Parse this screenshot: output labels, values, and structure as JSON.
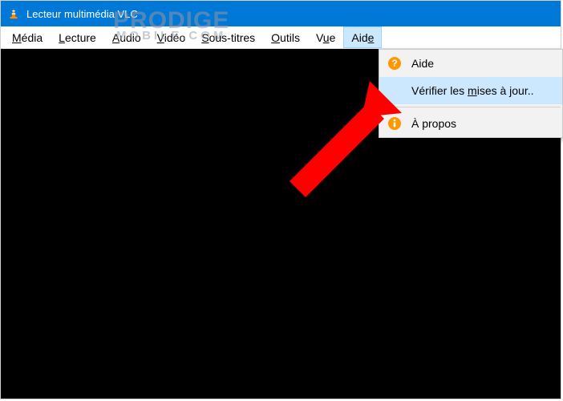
{
  "titlebar": {
    "title": "Lecteur multimédia VLC"
  },
  "watermark": {
    "main": "PRODIGE",
    "sub": "MOBILE.COM"
  },
  "menubar": {
    "items": [
      {
        "pre": "",
        "m": "M",
        "post": "édia"
      },
      {
        "pre": "",
        "m": "L",
        "post": "ecture"
      },
      {
        "pre": "",
        "m": "A",
        "post": "udio"
      },
      {
        "pre": "",
        "m": "V",
        "post": "idéo"
      },
      {
        "pre": "",
        "m": "S",
        "post": "ous-titres"
      },
      {
        "pre": "",
        "m": "O",
        "post": "utils"
      },
      {
        "pre": "V",
        "m": "u",
        "post": "e"
      },
      {
        "pre": "Aid",
        "m": "e",
        "post": ""
      }
    ],
    "open_index": 7
  },
  "dropdown": {
    "items": [
      {
        "icon": "help-icon",
        "pre": "",
        "m": "",
        "post": "Aide",
        "highlight": false
      },
      {
        "icon": "",
        "pre": "Vérifier les ",
        "m": "m",
        "post": "ises à jour..",
        "highlight": true
      },
      {
        "sep": true
      },
      {
        "icon": "info-icon",
        "pre": "",
        "m": "",
        "post": "À propos",
        "highlight": false
      }
    ]
  }
}
